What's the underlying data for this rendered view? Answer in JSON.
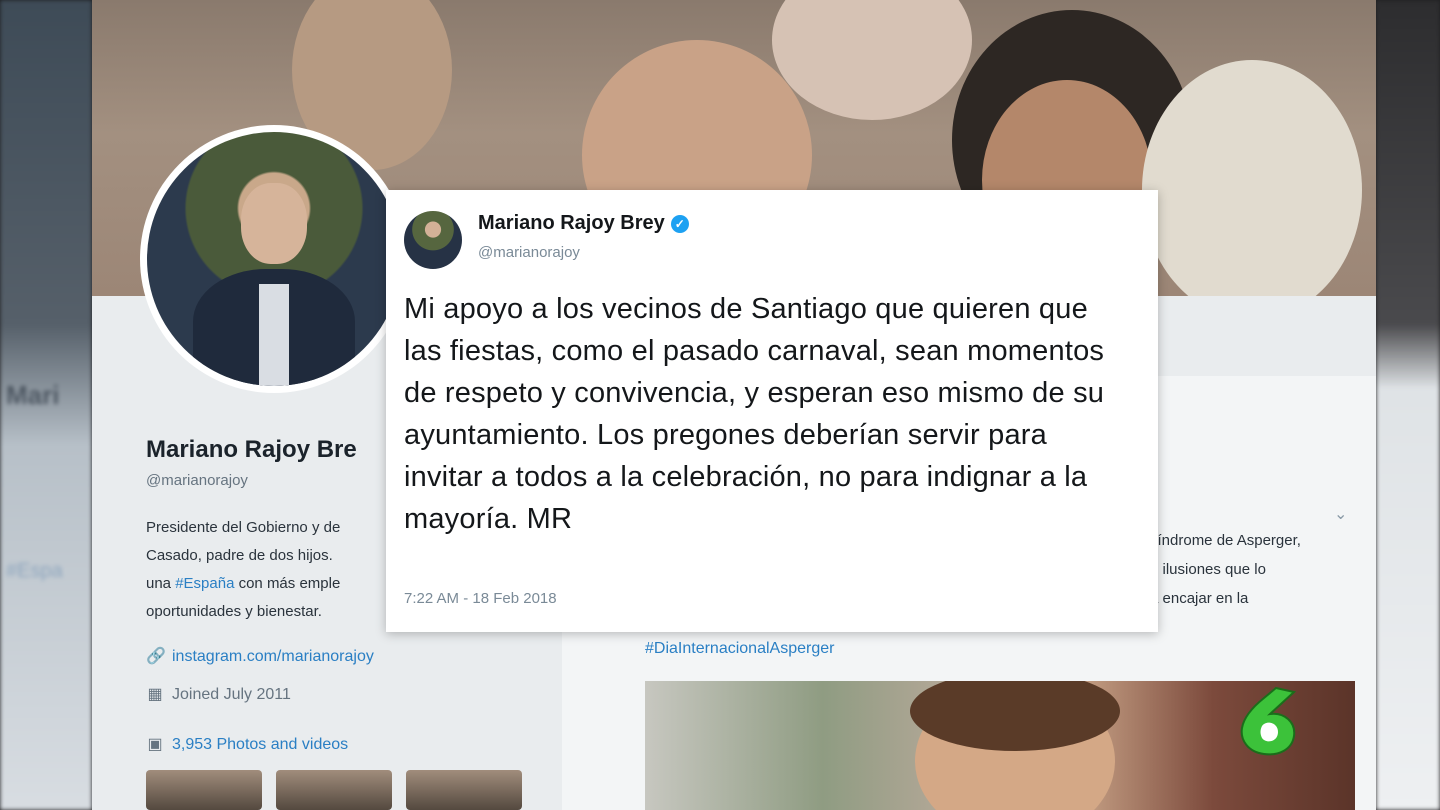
{
  "tweet": {
    "name": "Mariano Rajoy Brey",
    "handle": "@marianorajoy",
    "text": "Mi apoyo a los vecinos de Santiago que quieren que las fiestas, como el pasado carnaval, sean momentos de respeto y convivencia, y esperan eso mismo de su ayuntamiento. Los pregones deberían servir para invitar a todos a la celebración, no para indignar a la mayoría. MR",
    "time": "7:22 AM - 18 Feb 2018",
    "verified_icon": "check"
  },
  "profile": {
    "name": "Mariano Rajoy Bre",
    "handle": "@marianorajoy",
    "bio_line1": "Presidente del Gobierno y de",
    "bio_line2": "Casado, padre de dos hijos.",
    "bio_line3_pre": "una ",
    "bio_hashtag": "#España",
    "bio_line3_post": " con más emple",
    "bio_line4": "oportunidades y bienestar.",
    "link": "instagram.com/marianorajoy",
    "joined": "Joined July 2011",
    "photos": "3,953 Photos and videos"
  },
  "timeline": {
    "snippet_line1": "síndrome de Asperger,",
    "snippet_line2": "e ilusiones que lo",
    "snippet_line3": "a encajar en la",
    "hashtag": "#DiaInternacionalAsperger"
  },
  "colors": {
    "link_blue": "#2a7fc4",
    "verified_blue": "#1da1f2",
    "logo_green": "#3cc23a"
  }
}
